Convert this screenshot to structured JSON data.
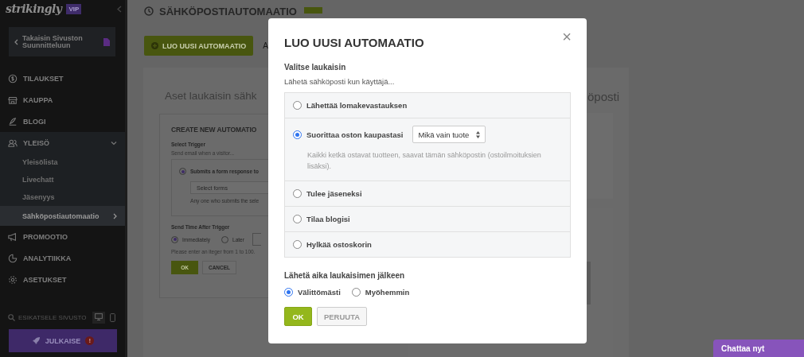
{
  "sidebar": {
    "logo": "strikingly",
    "badge": "VIP",
    "back_link": "Takaisin Sivuston Suunnitteluun",
    "nav": [
      {
        "label": "TILAUKSET",
        "selected": false
      },
      {
        "label": "KAUPPA",
        "selected": false
      },
      {
        "label": "BLOGI",
        "selected": false
      },
      {
        "label": "YLEISÖ",
        "selected": true,
        "expanded": true,
        "children": [
          {
            "label": "Yleisölista",
            "selected": false
          },
          {
            "label": "Livechatt",
            "selected": false
          },
          {
            "label": "Jäsenyys",
            "selected": false
          },
          {
            "label": "Sähköpostiautomaatio",
            "selected": true
          }
        ]
      },
      {
        "label": "PROMOOTIO",
        "selected": false
      },
      {
        "label": "ANALYTIIKKA",
        "selected": false
      },
      {
        "label": "ASETUKSET",
        "selected": false
      }
    ],
    "preview": "ESIKATSELE SIVUSTO",
    "publish_button": "JULKAISE",
    "publish_badge": "!"
  },
  "page": {
    "title": "SÄHKÖPOSTIAUTOMAATIO",
    "new_button": "LUO UUSI AUTOMAATIO",
    "tab_fragment": "A",
    "heading_left": "Aset laukaisin sähk",
    "heading_right": "öposti",
    "form": {
      "title": "CREATE NEW AUTOMATIO",
      "trigger_label": "Select Trigger",
      "trigger_hint": "Send email when a visitor...",
      "trigger_option": {
        "label": "Submits a form response to",
        "selected": true
      },
      "select_placeholder": "Select forms",
      "trigger_note": "Any one who submits the sele",
      "send_time_label": "Send Time After Trigger",
      "send_time_options": [
        {
          "label": "Immediately",
          "selected": true
        },
        {
          "label": "Later",
          "selected": false
        }
      ],
      "send_time_note": "Please enter an iteger  from 1 to 100.",
      "buttons": [
        "OK",
        "CANCEL"
      ]
    }
  },
  "modal": {
    "title": "LUO UUSI AUTOMAATIO",
    "close": "×",
    "trigger_label": "Valitse laukaisin",
    "trigger_hint": "Lähetä sähköposti kun käyttäjä...",
    "triggers": [
      {
        "label": "Lähettää lomakevastauksen",
        "selected": false
      },
      {
        "label": "Suorittaa oston kaupastasi",
        "selected": true,
        "dropdown": "Mikä vain tuote",
        "description": "Kaikki ketkä ostavat tuotteen, saavat tämän sähköpostin (ostoilmoituksien lisäksi)."
      },
      {
        "label": "Tulee jäseneksi",
        "selected": false
      },
      {
        "label": "Tilaa blogisi",
        "selected": false
      },
      {
        "label": "Hylkää ostoskorin",
        "selected": false
      }
    ],
    "send_time_label": "Lähetä aika laukaisimen jälkeen",
    "send_time_options": [
      {
        "label": "Välittömästi",
        "selected": true
      },
      {
        "label": "Myöhemmin",
        "selected": false
      }
    ],
    "buttons": [
      {
        "label": "OK",
        "kind": "primary"
      },
      {
        "label": "PERUUTA",
        "kind": "secondary"
      }
    ]
  },
  "chat_button": "Chattaa nyt"
}
